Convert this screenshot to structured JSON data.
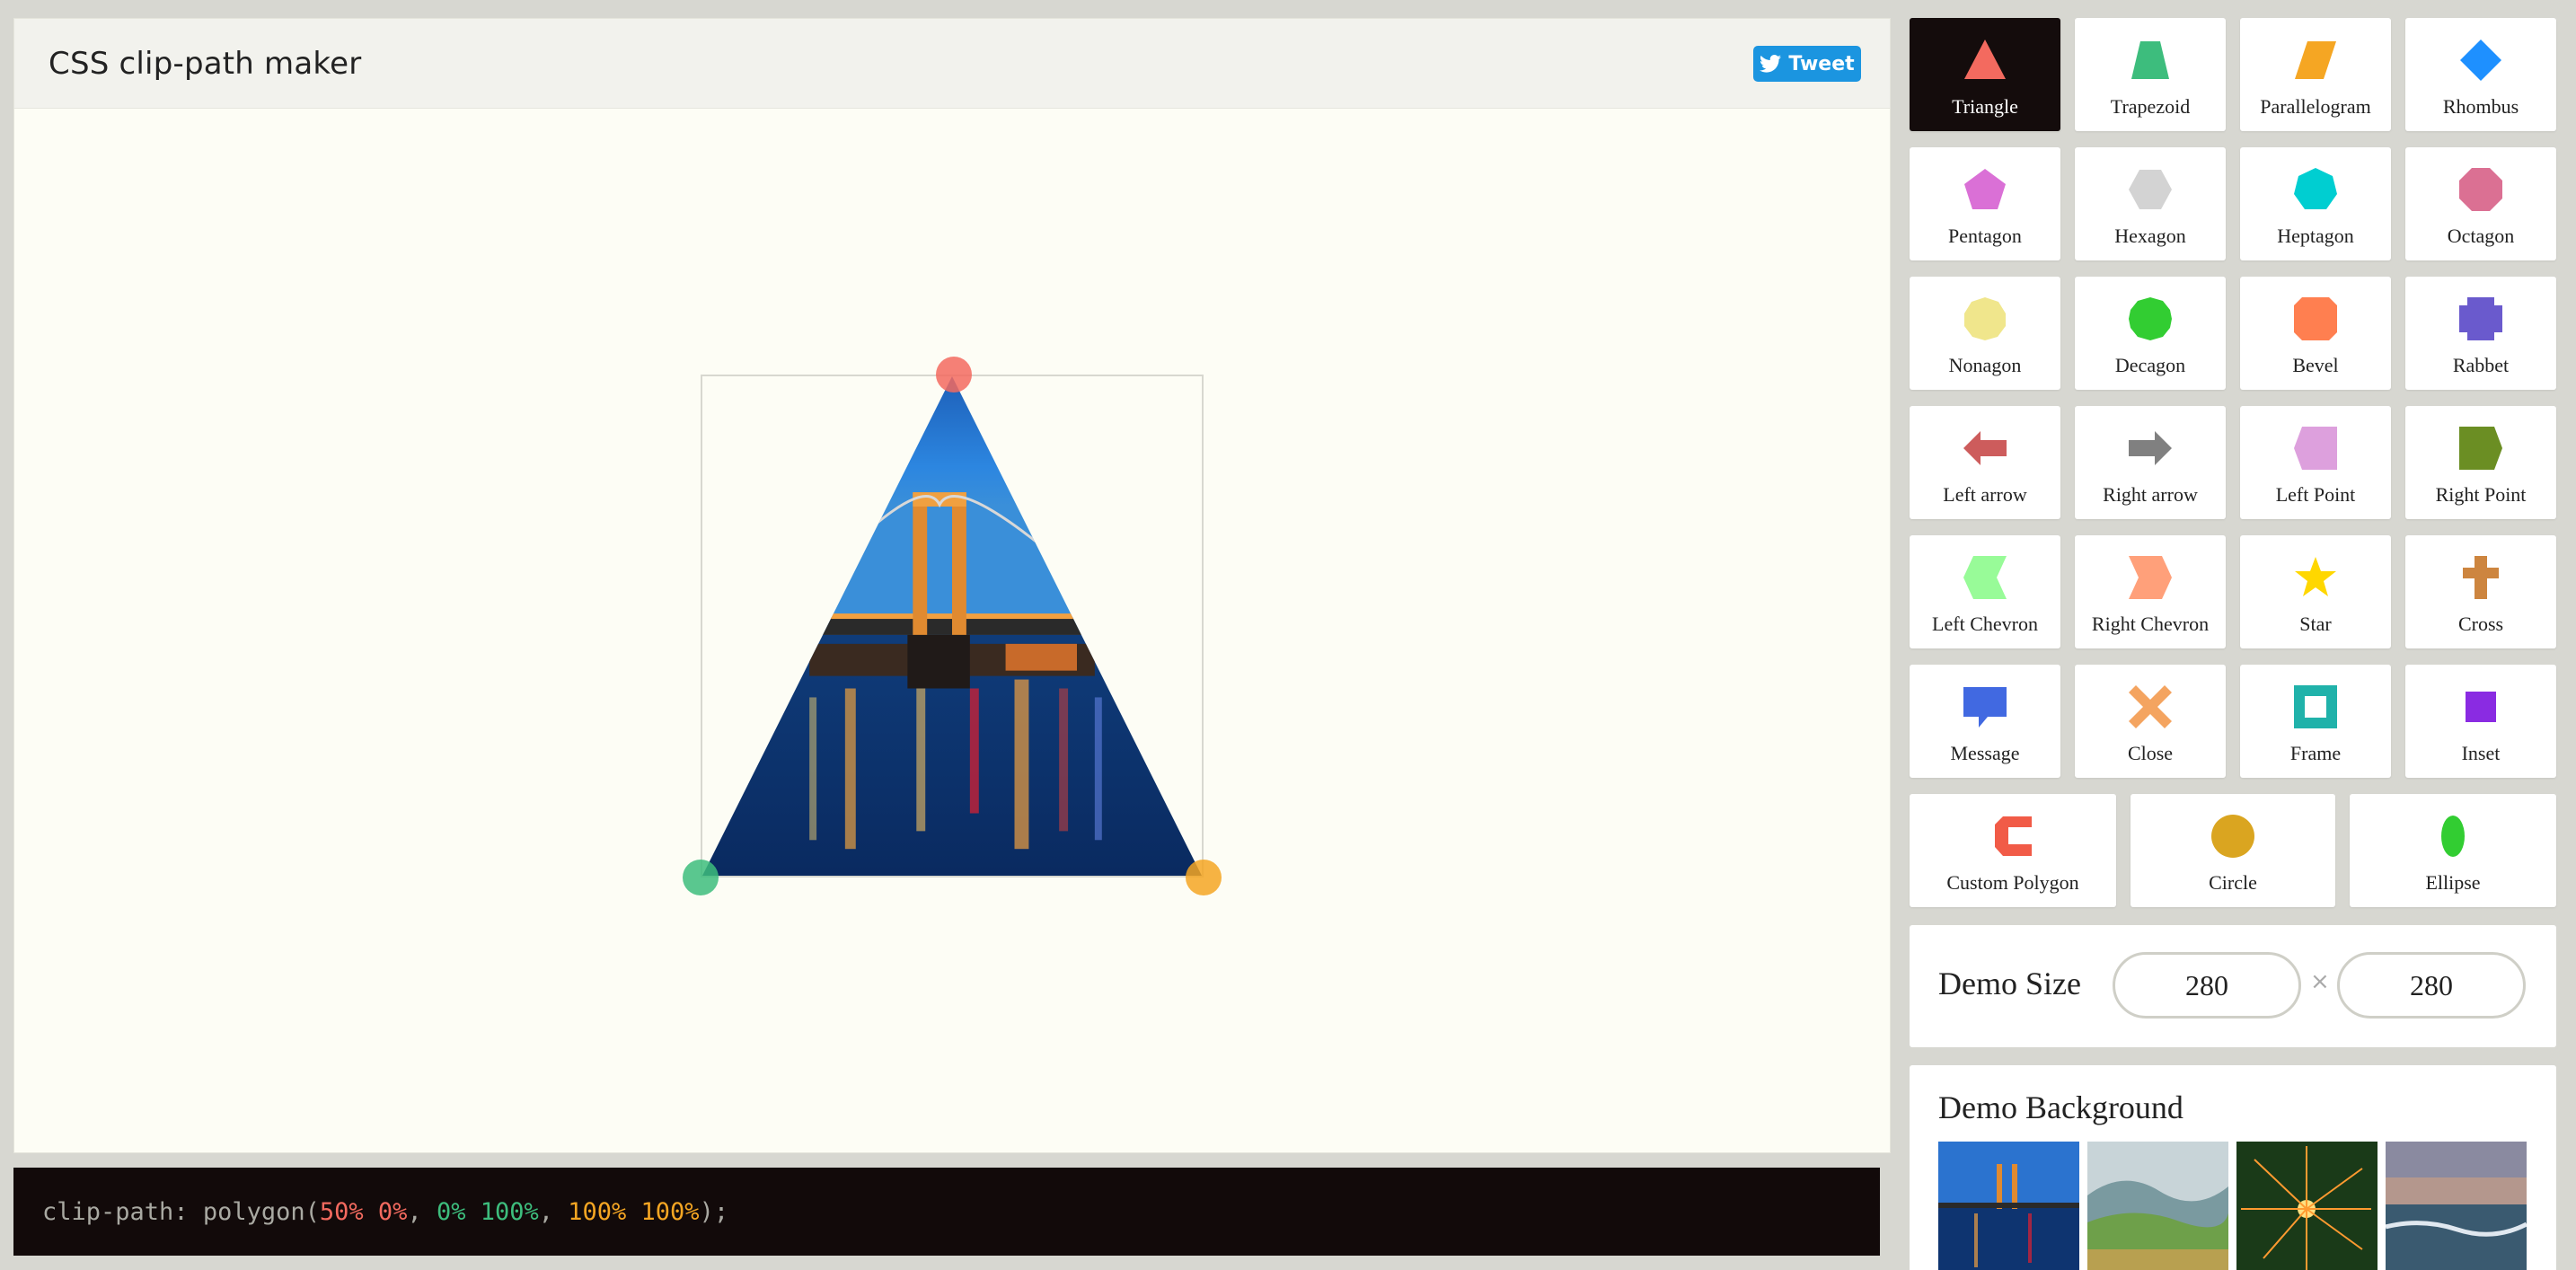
{
  "header": {
    "title": "CSS clip-path maker",
    "tweet_label": "Tweet"
  },
  "code": {
    "prop": "clip-path",
    "func": "polygon",
    "points": [
      {
        "text": "50% 0%",
        "color": "#f36a5f"
      },
      {
        "text": "0% 100%",
        "color": "#3dbd7d"
      },
      {
        "text": "100% 100%",
        "color": "#f5a623"
      }
    ]
  },
  "shapes": [
    {
      "label": "Triangle",
      "icon": "triangle-icon",
      "color": "#f36a5f",
      "selected": true
    },
    {
      "label": "Trapezoid",
      "icon": "trapezoid-icon",
      "color": "#3dbd7d"
    },
    {
      "label": "Parallelogram",
      "icon": "parallelogram-icon",
      "color": "#f5a623"
    },
    {
      "label": "Rhombus",
      "icon": "rhombus-icon",
      "color": "#1e90ff"
    },
    {
      "label": "Pentagon",
      "icon": "pentagon-icon",
      "color": "#da70d6"
    },
    {
      "label": "Hexagon",
      "icon": "hexagon-icon",
      "color": "#d3d3d3"
    },
    {
      "label": "Heptagon",
      "icon": "heptagon-icon",
      "color": "#00ced1"
    },
    {
      "label": "Octagon",
      "icon": "octagon-icon",
      "color": "#db7093"
    },
    {
      "label": "Nonagon",
      "icon": "nonagon-icon",
      "color": "#f0e68c"
    },
    {
      "label": "Decagon",
      "icon": "decagon-icon",
      "color": "#32cd32"
    },
    {
      "label": "Bevel",
      "icon": "bevel-icon",
      "color": "#ff7f50"
    },
    {
      "label": "Rabbet",
      "icon": "rabbet-icon",
      "color": "#6a5acd"
    },
    {
      "label": "Left arrow",
      "icon": "left-arrow-icon",
      "color": "#cd5c5c"
    },
    {
      "label": "Right arrow",
      "icon": "right-arrow-icon",
      "color": "#808080"
    },
    {
      "label": "Left Point",
      "icon": "left-point-icon",
      "color": "#dda0dd"
    },
    {
      "label": "Right Point",
      "icon": "right-point-icon",
      "color": "#6b8e23"
    },
    {
      "label": "Left Chevron",
      "icon": "left-chevron-icon",
      "color": "#98fb98"
    },
    {
      "label": "Right Chevron",
      "icon": "right-chevron-icon",
      "color": "#ffa07a"
    },
    {
      "label": "Star",
      "icon": "star-icon",
      "color": "#ffd700"
    },
    {
      "label": "Cross",
      "icon": "cross-icon",
      "color": "#cd853f"
    },
    {
      "label": "Message",
      "icon": "message-icon",
      "color": "#4169e1"
    },
    {
      "label": "Close",
      "icon": "close-icon",
      "color": "#f4a460"
    },
    {
      "label": "Frame",
      "icon": "frame-icon",
      "color": "#20b2aa"
    },
    {
      "label": "Inset",
      "icon": "inset-icon",
      "color": "#8a2be2"
    },
    {
      "label": "Custom Polygon",
      "icon": "custom-polygon-icon",
      "color": "#f15b47"
    },
    {
      "label": "Circle",
      "icon": "circle-icon",
      "color": "#daa520"
    },
    {
      "label": "Ellipse",
      "icon": "ellipse-icon",
      "color": "#32cd32"
    }
  ],
  "demo_size": {
    "label": "Demo Size",
    "width": "280",
    "height": "280",
    "separator": "×"
  },
  "demo_background": {
    "label": "Demo Background",
    "thumbnails": [
      "bridge-night-thumbnail",
      "green-hills-thumbnail",
      "sparkler-thumbnail",
      "sea-waves-thumbnail"
    ]
  }
}
